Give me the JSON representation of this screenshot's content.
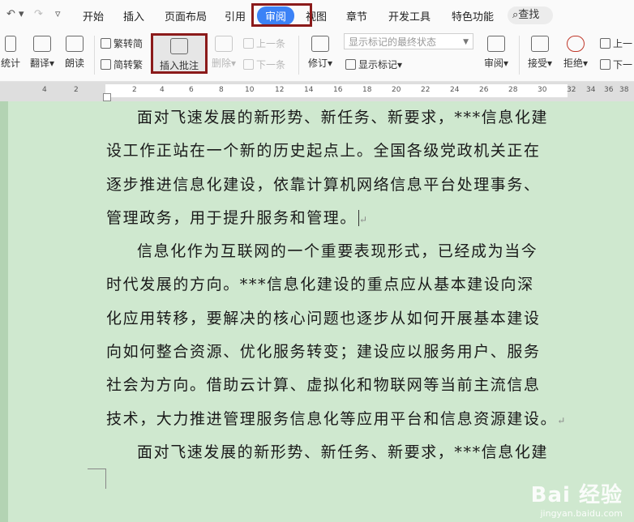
{
  "tabs": {
    "items": [
      {
        "label": "开始"
      },
      {
        "label": "插入"
      },
      {
        "label": "页面布局"
      },
      {
        "label": "引用"
      },
      {
        "label": "审阅"
      },
      {
        "label": "视图"
      },
      {
        "label": "章节"
      },
      {
        "label": "开发工具"
      },
      {
        "label": "特色功能"
      }
    ],
    "active": "审阅",
    "search_label": "查找",
    "active_color": "#3b82f6"
  },
  "ribbon": {
    "stats_label": "统计",
    "translate_label": "翻译",
    "read_aloud_label": "朗读",
    "to_traditional_label": "繁转简",
    "to_simplified_label": "简转繁",
    "insert_comment_label": "插入批注",
    "delete_label": "删除",
    "prev_comment_label": "上一条",
    "next_comment_label": "下一条",
    "track_changes_label": "修订",
    "display_combo_value": "显示标记的最终状态",
    "show_markup_label": "显示标记",
    "review_pane_label": "审阅",
    "accept_label": "接受",
    "reject_label": "拒绝",
    "prev_label": "上一",
    "next_label": "下一"
  },
  "ruler": {
    "ticks": [
      "4",
      "2",
      "2",
      "4",
      "6",
      "8",
      "10",
      "12",
      "14",
      "16",
      "18",
      "20",
      "22",
      "24",
      "26",
      "28",
      "30",
      "32",
      "34",
      "36",
      "38"
    ]
  },
  "document": {
    "lines": [
      {
        "text": "面对飞速发展的新形势、新任务、新要求，***信息化建",
        "indent": true
      },
      {
        "text": "设工作正站在一个新的历史起点上。全国各级党政机关正在",
        "indent": false
      },
      {
        "text": "逐步推进信息化建设，依靠计算机网络信息平台处理事务、",
        "indent": false
      },
      {
        "text": "管理政务，用于提升服务和管理。",
        "indent": false
      },
      {
        "text": "信息化作为互联网的一个重要表现形式，已经成为当今",
        "indent": true
      },
      {
        "text": "时代发展的方向。***信息化建设的重点应从基本建设向深",
        "indent": false
      },
      {
        "text": "化应用转移，要解决的核心问题也逐步从如何开展基本建设",
        "indent": false
      },
      {
        "text": "向如何整合资源、优化服务转变；建设应以服务用户、服务",
        "indent": false
      },
      {
        "text": "社会为方向。借助云计算、虚拟化和物联网等当前主流信息",
        "indent": false
      },
      {
        "text": "技术，大力推进管理服务信息化等应用平台和信息资源建设。",
        "indent": false
      },
      {
        "text": "面对飞速发展的新形势、新任务、新要求，***信息化建",
        "indent": true
      }
    ],
    "background": "#cfe8cf"
  },
  "watermark": {
    "logo": "Bai 经验",
    "url": "jingyan.baidu.com"
  }
}
